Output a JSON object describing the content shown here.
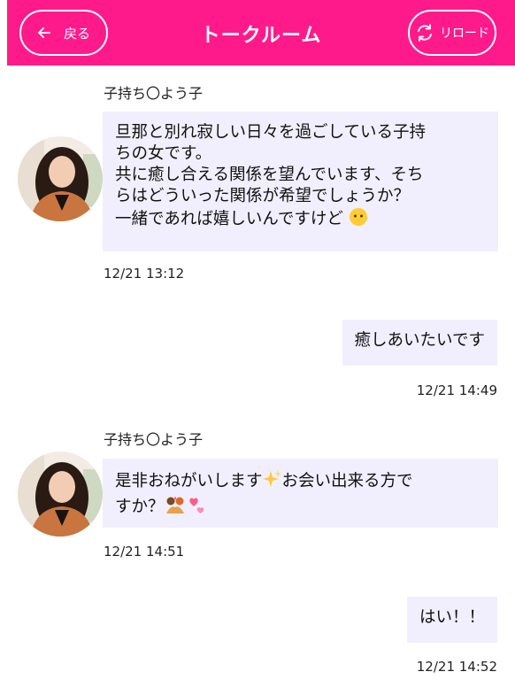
{
  "header": {
    "back_label": "戻る",
    "title": "トークルーム",
    "reload_label": "リロード",
    "color": "#ff1a8c"
  },
  "messages": [
    {
      "direction": "incoming",
      "sender": "子持ち〇よう子",
      "lines": [
        "旦那と別れ寂しい日々を過ごしている子持",
        "ちの女です。",
        "共に癒し合える関係を望んでいます、そち",
        "らはどういった関係が希望でしょうか？",
        "一緒であれば嬉しいんですけど"
      ],
      "trailing_emoji": "no-mouth-face",
      "time": "12/21 13:12"
    },
    {
      "direction": "outgoing",
      "text": "癒しあいたいです",
      "time": "12/21 14:49"
    },
    {
      "direction": "incoming",
      "sender": "子持ち〇よう子",
      "lines": [
        "是非おねがいします",
        "お会い出来る方で",
        "すか？"
      ],
      "emojis": [
        "sparkles",
        "kiss",
        "two-hearts"
      ],
      "time": "12/21 14:51"
    },
    {
      "direction": "outgoing",
      "text": "はい！！",
      "time": "12/21 14:52"
    }
  ],
  "colors": {
    "bubble": "#f1effd",
    "text": "#111111"
  }
}
